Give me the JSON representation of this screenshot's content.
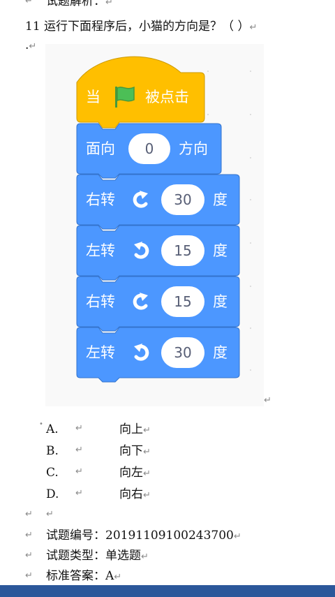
{
  "doc": {
    "analysis_heading": "试题解析：",
    "question_text": "11 运行下面程序后，小猫的方向是？（    ）",
    "dot_mark": ".",
    "return_mark": "↵",
    "options": [
      {
        "letter": "A.",
        "text": "向上"
      },
      {
        "letter": "B.",
        "text": "向下"
      },
      {
        "letter": "C.",
        "text": "向左"
      },
      {
        "letter": "D.",
        "text": "向右"
      }
    ],
    "meta": [
      {
        "label": "试题编号：",
        "value": "20191109100243700"
      },
      {
        "label": "试题类型：",
        "value": "单选题"
      },
      {
        "label": "标准答案：",
        "value": "A"
      }
    ]
  },
  "scratch": {
    "hat": {
      "prefix": "当",
      "suffix": "被点击",
      "icon": "green-flag-icon"
    },
    "point": {
      "label": "面向",
      "value": "0",
      "unit": "方向"
    },
    "turns": [
      {
        "label": "右转",
        "icon": "rotate-clockwise-icon",
        "value": "30",
        "unit": "度"
      },
      {
        "label": "左转",
        "icon": "rotate-counterclockwise-icon",
        "value": "15",
        "unit": "度"
      },
      {
        "label": "右转",
        "icon": "rotate-clockwise-icon",
        "value": "15",
        "unit": "度"
      },
      {
        "label": "左转",
        "icon": "rotate-counterclockwise-icon",
        "value": "30",
        "unit": "度"
      }
    ]
  },
  "colors": {
    "event_block": "#ffbf00",
    "motion_block": "#4c97ff",
    "block_border": "#3373cc",
    "flag_green": "#4cbf56",
    "footer_bar": "#2b579a"
  }
}
